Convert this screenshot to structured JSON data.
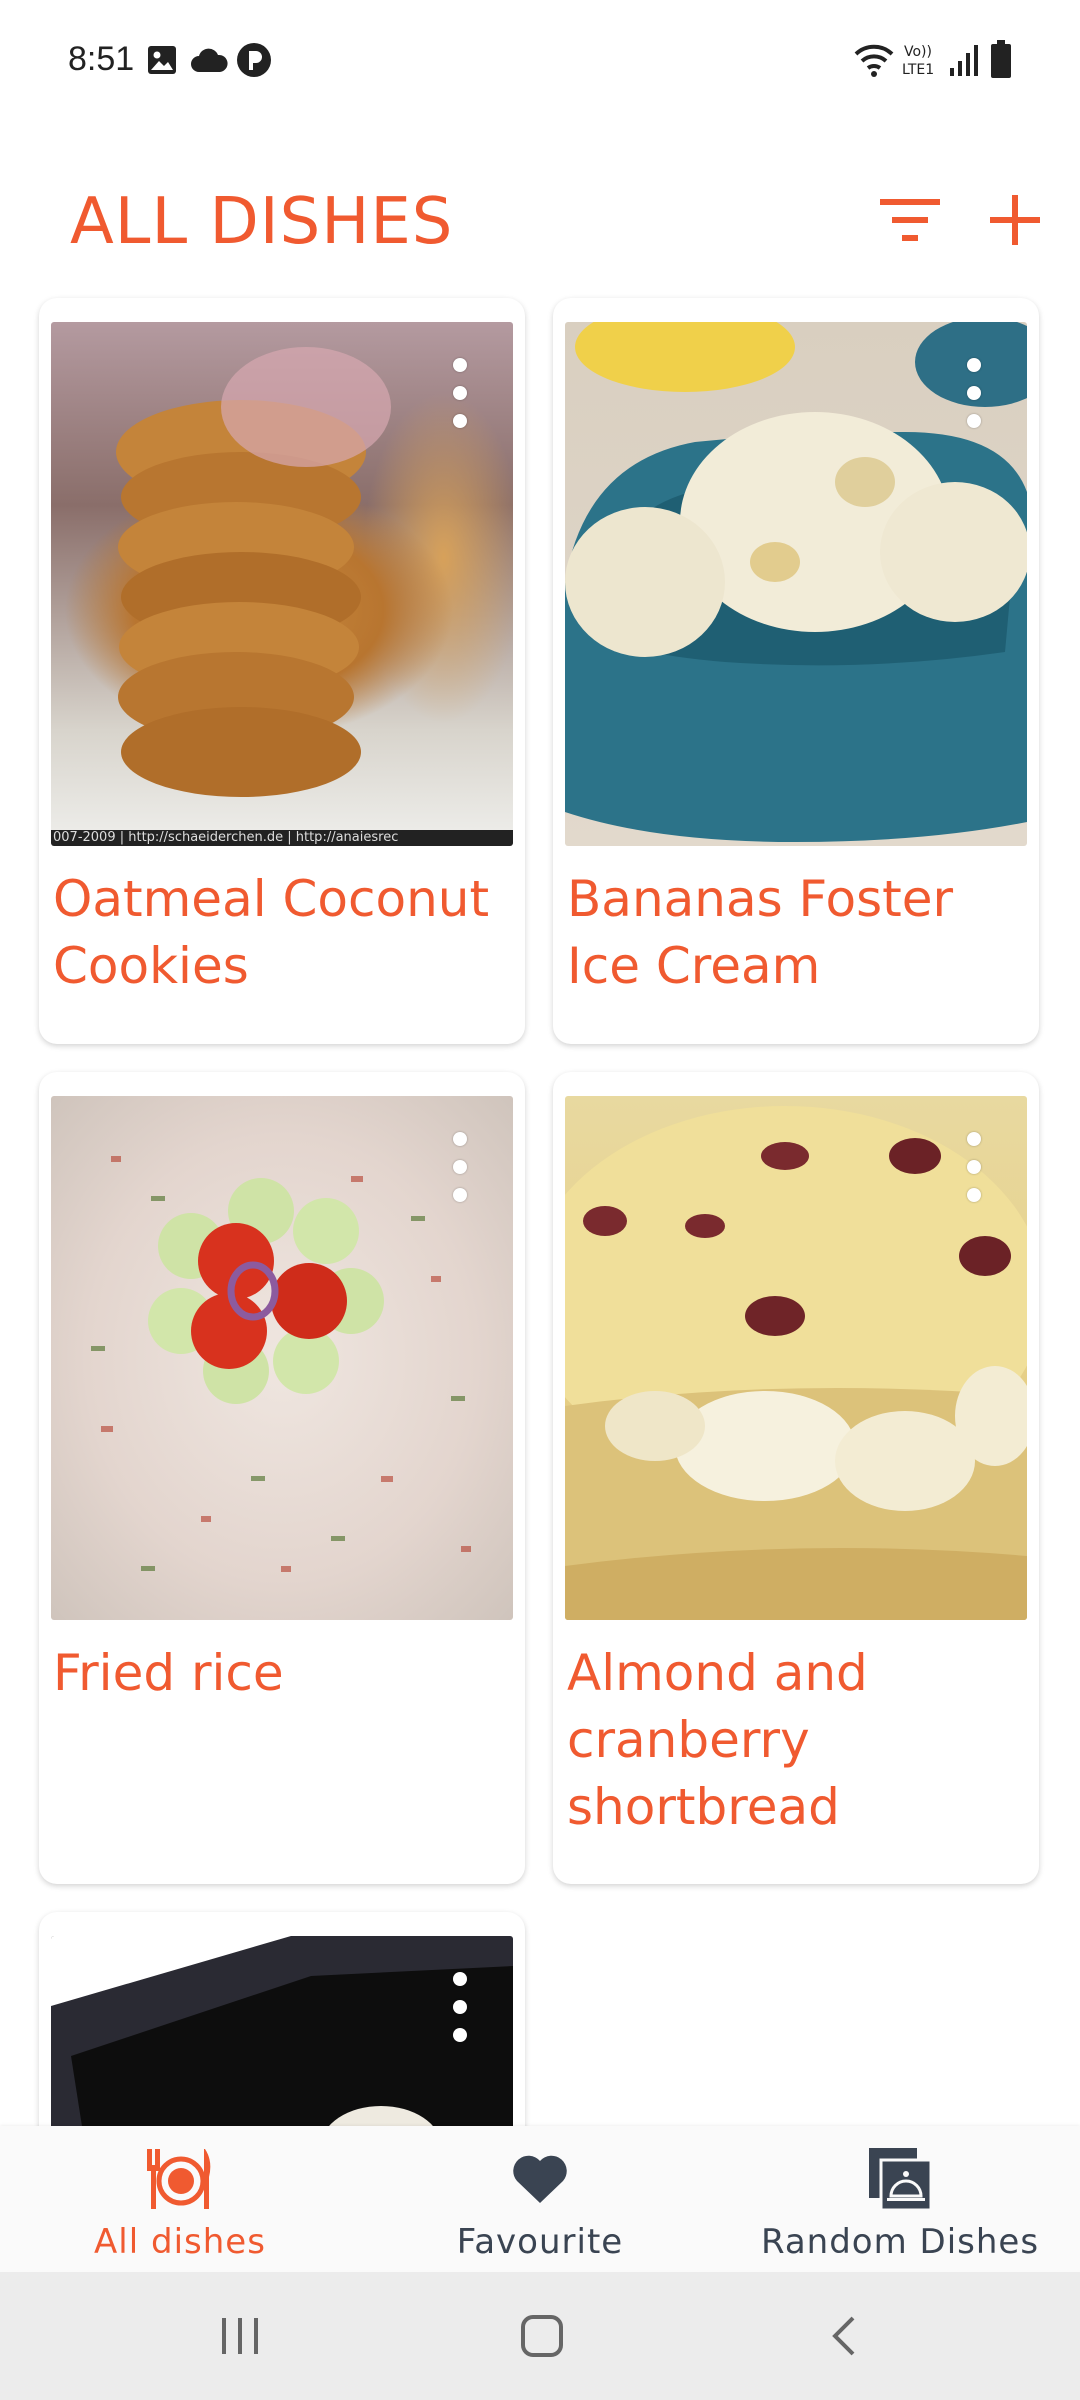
{
  "status_bar": {
    "time": "8:51"
  },
  "header": {
    "title": "ALL DISHES"
  },
  "colors": {
    "accent": "#f05a30",
    "dark_icon": "#3a4452"
  },
  "dishes": [
    {
      "title": "Oatmeal Coconut Cookies",
      "image": "oatmeal-cookies-photo",
      "watermark": "007-2009 | http://schaeiderchen.de | http://anaiesrec"
    },
    {
      "title": "Bananas Foster Ice Cream",
      "image": "ice-cream-bowl-photo"
    },
    {
      "title": "Fried rice",
      "image": "fried-rice-photo"
    },
    {
      "title": "Almond and cranberry shortbread",
      "image": "shortbread-photo"
    },
    {
      "title": "",
      "image": "dish-photo-partial"
    }
  ],
  "bottom_nav": {
    "items": [
      {
        "label": "All dishes",
        "icon": "plate-cutlery-icon",
        "active": true
      },
      {
        "label": "Favourite",
        "icon": "heart-icon",
        "active": false
      },
      {
        "label": "Random Dishes",
        "icon": "cloche-icon",
        "active": false
      }
    ]
  }
}
